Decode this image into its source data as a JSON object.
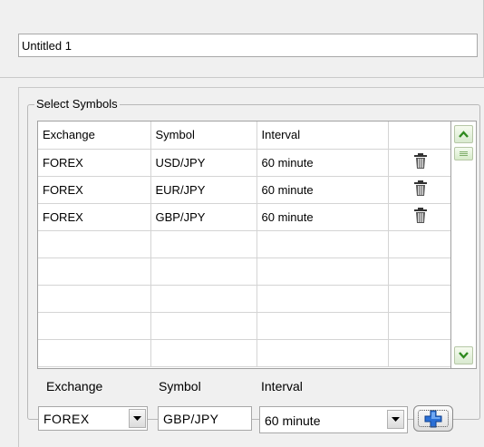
{
  "document": {
    "name_value": "Untitled 1"
  },
  "group": {
    "title": "Select Symbols"
  },
  "table": {
    "columns": [
      "Exchange",
      "Symbol",
      "Interval",
      ""
    ],
    "rows": [
      {
        "exchange": "FOREX",
        "symbol": "USD/JPY",
        "interval": "60 minute",
        "action_icon": "trash-icon"
      },
      {
        "exchange": "FOREX",
        "symbol": "EUR/JPY",
        "interval": "60 minute",
        "action_icon": "trash-icon"
      },
      {
        "exchange": "FOREX",
        "symbol": "GBP/JPY",
        "interval": "60 minute",
        "action_icon": "trash-icon"
      }
    ],
    "empty_rows": 5
  },
  "form": {
    "exchange_label": "Exchange",
    "symbol_label": "Symbol",
    "interval_label": "Interval",
    "exchange_value": "FOREX",
    "symbol_value": "GBP/JPY",
    "interval_value": "60 minute",
    "add_icon": "plus-icon"
  },
  "colors": {
    "scroll_arrow": "#2f8a1f",
    "add_plus": "#2a6fd6"
  }
}
